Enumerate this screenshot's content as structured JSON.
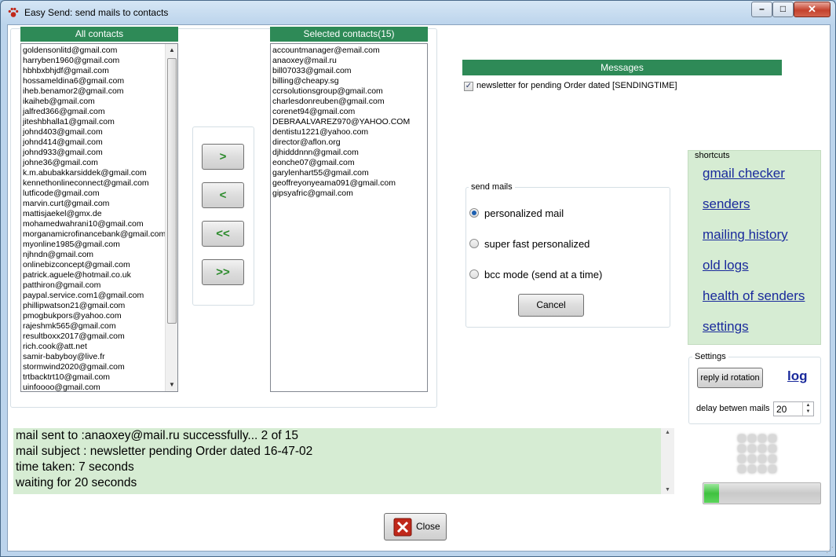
{
  "window": {
    "title": "Easy Send: send mails to contacts",
    "minimize": "–",
    "maximize": "□",
    "close": "✕"
  },
  "all_contacts": {
    "header": "All contacts",
    "items": [
      "goldensonlitd@gmail.com",
      "harryben1960@gmail.com",
      "hbhbxbhjdf@gmail.com",
      "hossameldina6@gmail.com",
      "iheb.benamor2@gmail.com",
      "ikaiheb@gmail.com",
      "jalfred366@gmail.com",
      "jiteshbhalla1@gmail.com",
      "johnd403@gmail.com",
      "johnd414@gmail.com",
      "johnd933@gmail.com",
      "johne36@gmail.com",
      "k.m.abubakkarsiddek@gmail.com",
      "kennethonlineconnect@gmail.com",
      "lutficode@gmail.com",
      "marvin.curt@gmail.com",
      "mattisjaekel@gmx.de",
      "mohamedwahrani10@gmail.com",
      "morganamicrofinancebank@gmail.com",
      "myonline1985@gmail.com",
      "njhndn@gmail.com",
      "onlinebizconcept@gmail.com",
      "patrick.aguele@hotmail.co.uk",
      "patthiron@gmail.com",
      "paypal.service.com1@gmail.com",
      "phillipwatson21@gmail.com",
      "pmogbukpors@yahoo.com",
      "rajeshmk565@gmail.com",
      "resultboxx2017@gmail.com",
      "rich.cook@att.net",
      "samir-babyboy@live.fr",
      "stormwind2020@gmail.com",
      "trtbacktrt10@gmail.com",
      "uinfoooo@gmail.com"
    ]
  },
  "selected_contacts": {
    "header": "Selected contacts(15)",
    "items": [
      "accountmanager@email.com",
      "anaoxey@mail.ru",
      "bill07033@gmail.com",
      "billing@cheapy.sg",
      "ccrsolutionsgroup@gmail.com",
      "charlesdonreuben@gmail.com",
      "corenet94@gmail.com",
      "DEBRAALVAREZ970@YAHOO.COM",
      "dentistu1221@yahoo.com",
      "director@aflon.org",
      "djhidddnnn@gmail.com",
      "eonche07@gmail.com",
      "garylenhart55@gmail.com",
      "geoffreyonyeama091@gmail.com",
      "gipsyafric@gmail.com"
    ]
  },
  "move_buttons": {
    "add": ">",
    "remove": "<",
    "remove_all": "<<",
    "add_all": ">>"
  },
  "messages": {
    "header": "Messages",
    "item_label": "newsletter for pending Order dated [SENDINGTIME]",
    "checked": true
  },
  "send_mails": {
    "legend": "send mails",
    "options": [
      "personalized mail",
      "super fast personalized",
      "bcc mode (send at a time)"
    ],
    "selected_index": 0,
    "cancel_label": "Cancel"
  },
  "shortcuts": {
    "legend": "shortcuts",
    "links": [
      "gmail checker",
      "senders",
      "mailing history",
      "old logs",
      "health of senders",
      "settings"
    ]
  },
  "settings": {
    "legend": "Settings",
    "reply_rotation_label": "reply id rotation",
    "log_link": "log",
    "delay_label": "delay betwen mails",
    "delay_value": "20"
  },
  "log": {
    "lines": [
      "mail sent to :anaoxey@mail.ru successfully... 2 of 15",
      "mail subject : newsletter pending Order dated 16-47-02",
      "time taken: 7 seconds",
      "waiting for 20 seconds"
    ]
  },
  "progress": {
    "fraction": 0.13
  },
  "close_button": {
    "label": "Close"
  },
  "colors": {
    "header_green": "#2e8a57",
    "panel_green": "#d6ecd3",
    "link_blue": "#1a2a9c"
  }
}
